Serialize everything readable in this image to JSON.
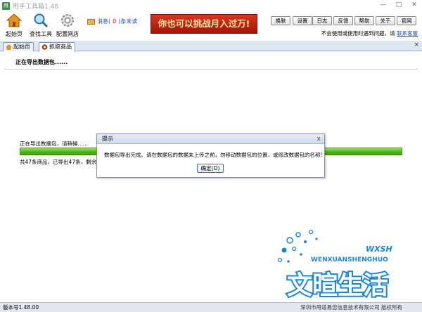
{
  "window": {
    "title": "甩手工具箱1.48",
    "app_icon_char": "甩",
    "controls": {
      "minimize": "—",
      "maximize": "□",
      "close": "✕"
    }
  },
  "toolbar": {
    "tools": [
      {
        "label": "起始页",
        "icon": "home-icon"
      },
      {
        "label": "查找工具",
        "icon": "magnifier-icon"
      },
      {
        "label": "配置网店",
        "icon": "gear-icon"
      }
    ],
    "message": {
      "prefix": "消息(",
      "count": "0",
      "suffix": ")条未读"
    },
    "banner": "你也可以挑战月入过万!",
    "buttons": [
      "换肤",
      "设置",
      "日志",
      "反馈",
      "帮助",
      "关于",
      "官网"
    ],
    "notice_text": "不会使用或使用时遇到问题，请",
    "notice_link": "联系客服"
  },
  "tabs": [
    {
      "label": "起始页",
      "icon": "home-icon"
    },
    {
      "label": "抓取商品",
      "icon": "grab-icon"
    }
  ],
  "content": {
    "header": "正在导出数据包......",
    "export_status": "正在导出数据包，请稍候......",
    "progress": 1.0,
    "summary": "共47条商品，已导出47条，剩余0"
  },
  "dialog": {
    "title": "提示",
    "close": "x",
    "message": "数据包导出完成。请在数据包的数据未上传之前，勿移动数据包的位置，或修改数据包的名称!",
    "ok_label": "确定(O)"
  },
  "watermark": {
    "latin_top": "WXSH",
    "latin_full": "WENXUANSHENGHUO",
    "chinese": "文暄生活"
  },
  "statusbar": {
    "version": "版本号1.48.00",
    "copyright": "深圳市甩道易您信息技术有限公司 版权所有"
  },
  "colors": {
    "banner_bg": "#c0261a",
    "banner_text": "#f6e7a2",
    "progress": "#4cb51b",
    "link": "#1a4fb5",
    "watermark_blue": "#1f86d6"
  }
}
